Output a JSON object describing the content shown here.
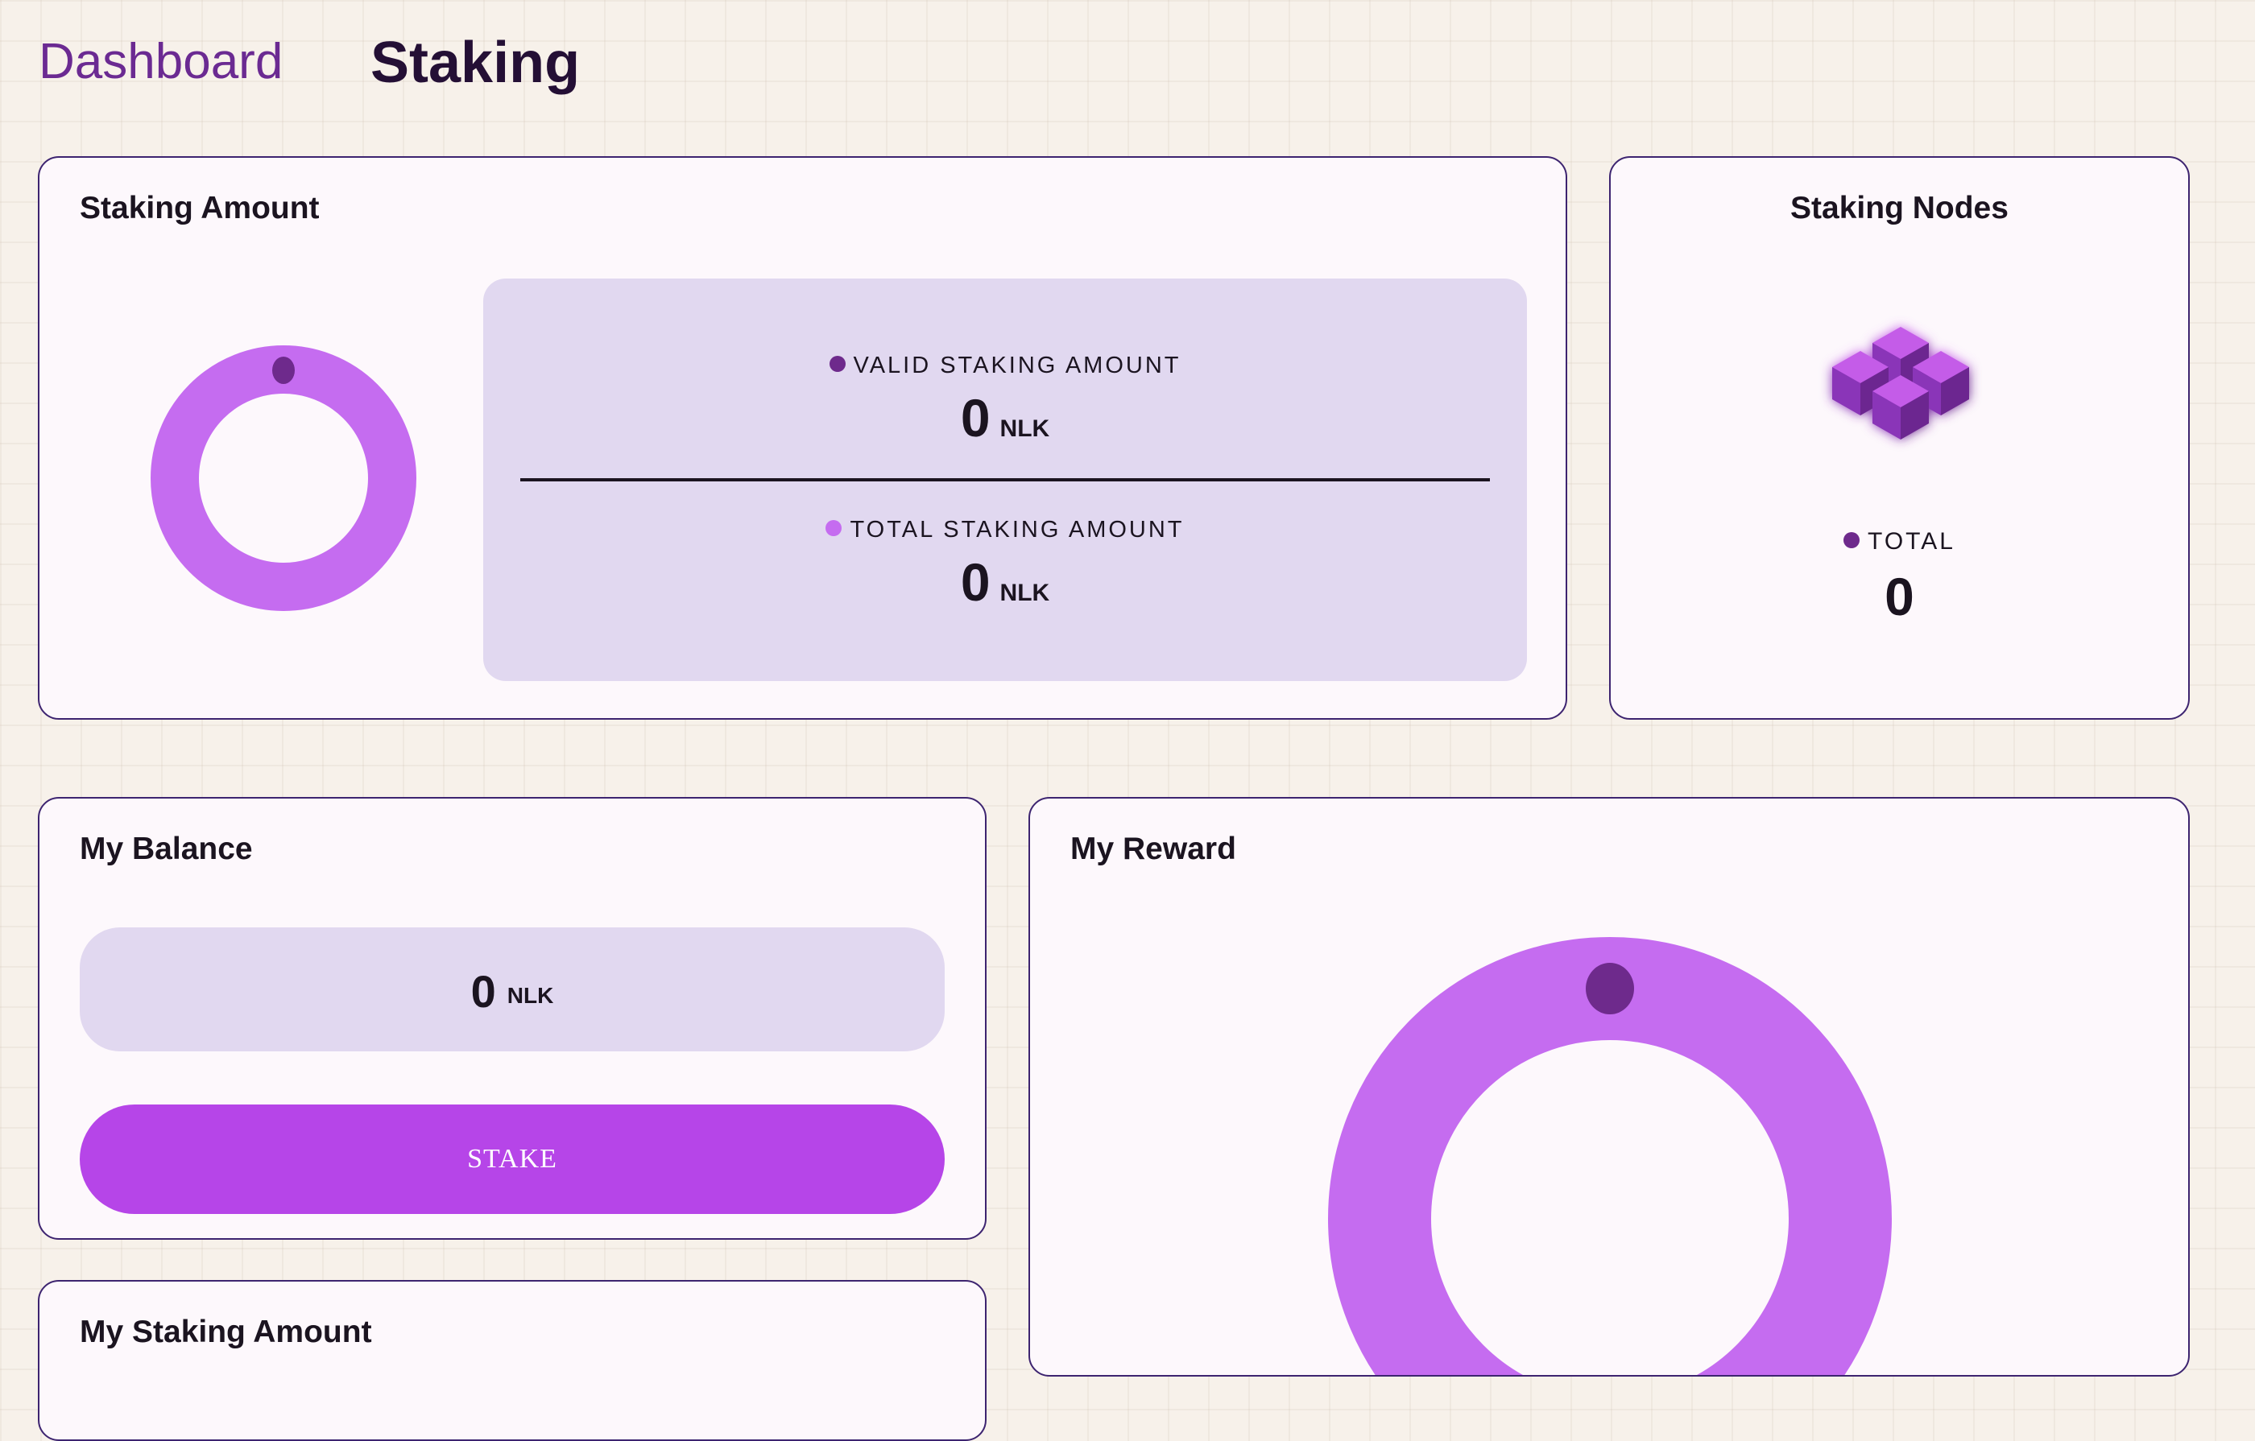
{
  "header": {
    "nav_link": "Dashboard",
    "title": "Staking"
  },
  "staking_amount": {
    "title": "Staking Amount",
    "valid": {
      "label": "VALID STAKING AMOUNT",
      "value": "0",
      "unit": "NLK",
      "dot_color": "#6e2a8c"
    },
    "total": {
      "label": "TOTAL STAKING AMOUNT",
      "value": "0",
      "unit": "NLK",
      "dot_color": "#c56cf0"
    },
    "chart_colors": {
      "ring": "#c56cf0",
      "marker": "#6e2a8c"
    }
  },
  "staking_nodes": {
    "title": "Staking Nodes",
    "icon": "nodes-cubes-icon",
    "total_label": "TOTAL",
    "total_value": "0"
  },
  "my_balance": {
    "title": "My Balance",
    "value": "0",
    "unit": "NLK",
    "stake_button": "STAKE"
  },
  "my_reward": {
    "title": "My Reward"
  },
  "my_staking_amount": {
    "title": "My Staking Amount"
  },
  "colors": {
    "accent": "#b645e8",
    "border": "#3d2470",
    "panel": "#e1d8f0",
    "nav_link": "#6b2a92"
  }
}
